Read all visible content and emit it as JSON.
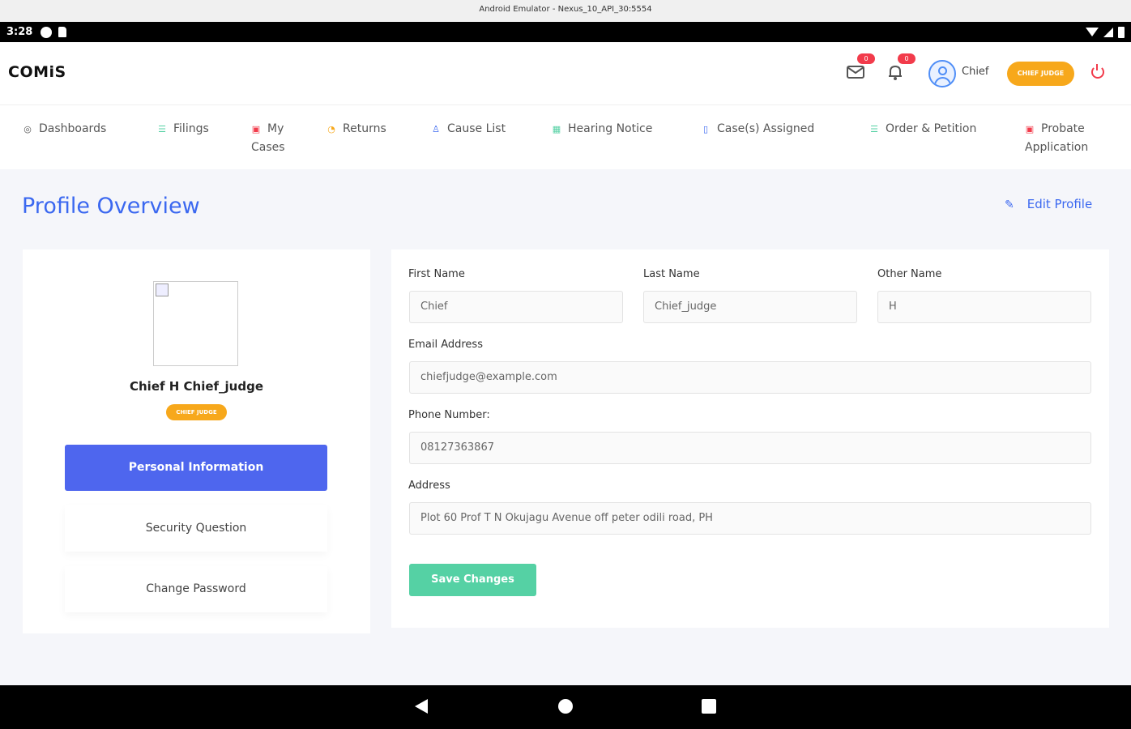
{
  "emulator": {
    "title": "Android Emulator - Nexus_10_API_30:5554"
  },
  "status_bar": {
    "time": "3:28"
  },
  "header": {
    "logo": "COMiS",
    "mail_badge": "0",
    "bell_badge": "0",
    "user": "Chief",
    "role": "CHIEF JUDGE"
  },
  "nav": {
    "items": [
      {
        "label": "Dashboards",
        "icon": "dashboard-icon"
      },
      {
        "label": "Filings",
        "icon": "list-icon"
      },
      {
        "label_line1": "My",
        "label_line2": "Cases",
        "icon": "folder-icon"
      },
      {
        "label": "Returns",
        "icon": "return-icon"
      },
      {
        "label": "Cause List",
        "icon": "person-icon"
      },
      {
        "label": "Hearing Notice",
        "icon": "calendar-icon"
      },
      {
        "label": "Case(s) Assigned",
        "icon": "document-icon"
      },
      {
        "label": "Order & Petition",
        "icon": "list-icon"
      },
      {
        "label_line1": "Probate",
        "label_line2": "Application",
        "icon": "folder-icon"
      }
    ]
  },
  "page": {
    "title": "Profile Overview",
    "edit_label": "Edit Profile"
  },
  "profile": {
    "name": "Chief H Chief_judge",
    "role": "CHIEF JUDGE",
    "tabs": {
      "personal": "Personal Information",
      "security": "Security Question",
      "password": "Change Password"
    }
  },
  "form": {
    "first_name_label": "First Name",
    "first_name": "Chief",
    "last_name_label": "Last Name",
    "last_name": "Chief_judge",
    "other_name_label": "Other Name",
    "other_name": "H",
    "email_label": "Email Address",
    "email": "chiefjudge@example.com",
    "phone_label": "Phone Number:",
    "phone": "08127363867",
    "address_label": "Address",
    "address": "Plot 60 Prof T N Okujagu Avenue off peter odili road, PH",
    "save_label": "Save Changes"
  },
  "colors": {
    "accent": "#3b68f0",
    "primary_button": "#4e66ee",
    "save_button": "#55d1a4",
    "role_pill": "#f7a81b",
    "badge": "#f23b4b"
  }
}
